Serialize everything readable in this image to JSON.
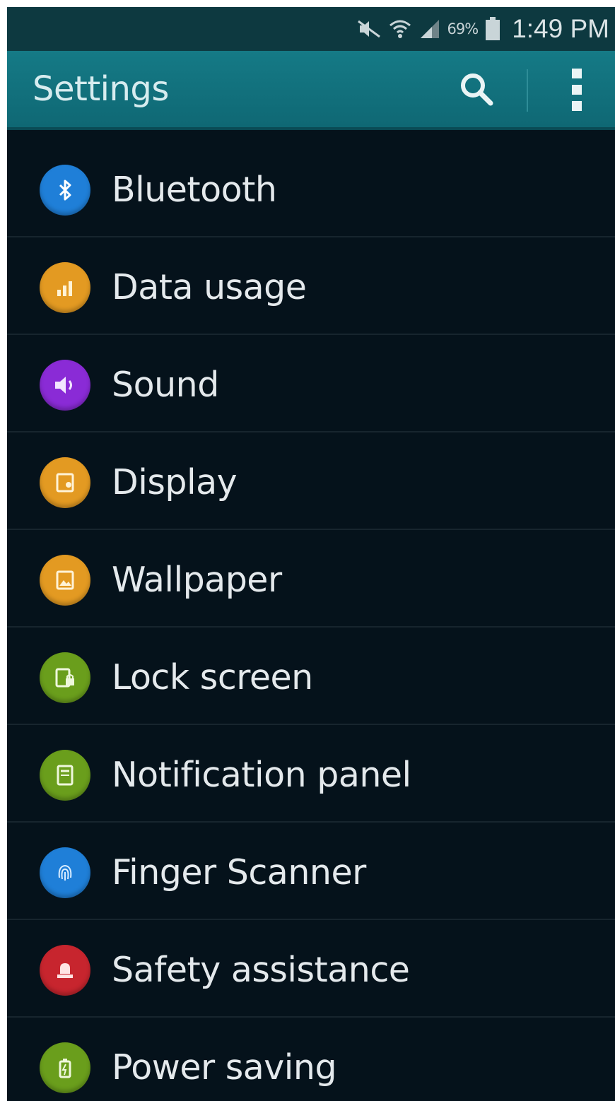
{
  "status_bar": {
    "icons": [
      "mute-icon",
      "wifi-icon",
      "signal-icon",
      "battery-icon"
    ],
    "battery": "69%",
    "time": "1:49 PM"
  },
  "app_bar": {
    "title": "Settings",
    "actions": [
      "search-icon",
      "more-vert-icon"
    ]
  },
  "settings": {
    "items": [
      {
        "label": "Bluetooth",
        "icon": "bluetooth-icon",
        "color": "#1f7fd8"
      },
      {
        "label": "Data usage",
        "icon": "data-usage-icon",
        "color": "#e39a22"
      },
      {
        "label": "Sound",
        "icon": "sound-icon",
        "color": "#8a2bd6"
      },
      {
        "label": "Display",
        "icon": "display-icon",
        "color": "#e39a22"
      },
      {
        "label": "Wallpaper",
        "icon": "wallpaper-icon",
        "color": "#e39a22"
      },
      {
        "label": "Lock screen",
        "icon": "lock-screen-icon",
        "color": "#6a9e1c"
      },
      {
        "label": "Notification panel",
        "icon": "notification-panel-icon",
        "color": "#6a9e1c"
      },
      {
        "label": "Finger Scanner",
        "icon": "fingerprint-icon",
        "color": "#1f7fd8"
      },
      {
        "label": "Safety assistance",
        "icon": "safety-icon",
        "color": "#c7252e"
      },
      {
        "label": "Power saving",
        "icon": "power-saving-icon",
        "color": "#6a9e1c"
      }
    ]
  }
}
